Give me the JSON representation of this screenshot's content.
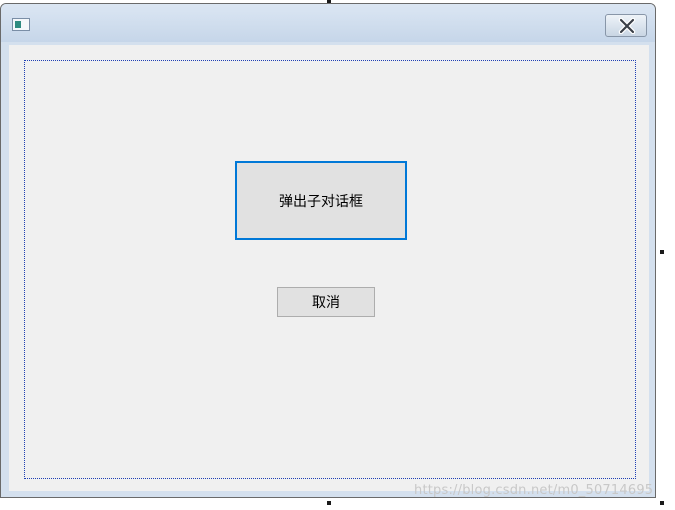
{
  "dialog": {
    "popup_button_label": "弹出子对话框",
    "cancel_button_label": "取消"
  },
  "watermark": {
    "text": "https://blog.csdn.net/m0_50714695"
  },
  "colors": {
    "focus_border": "#0078d7",
    "client_background": "#f0f0f0",
    "frame_dotted": "#1f3fb4",
    "button_face": "#e1e1e1"
  },
  "icons": {
    "title_icon": "app-icon",
    "close": "close-icon"
  }
}
